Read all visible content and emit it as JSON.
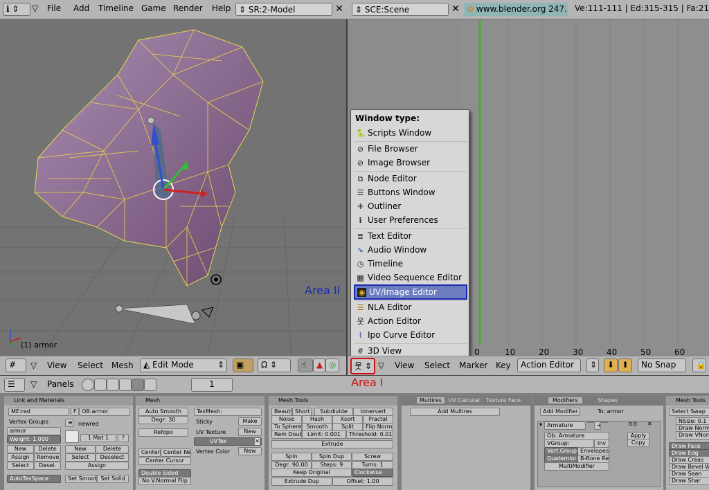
{
  "topbar": {
    "menus": [
      "File",
      "Add",
      "Timeline",
      "Game",
      "Render",
      "Help"
    ],
    "screen": "SR:2-Model",
    "scene": "SCE:Scene",
    "url": "www.blender.org 247.1",
    "stats": "Ve:111-111 | Ed:315-315 | Fa:21"
  },
  "viewport": {
    "object_label": "(1) armor",
    "area_ii_label": "Area II",
    "area_i_label": "Area I"
  },
  "left_header": {
    "view": "View",
    "select": "Select",
    "mesh": "Mesh",
    "mode": "Edit Mode"
  },
  "right_header": {
    "view": "View",
    "select": "Select",
    "marker": "Marker",
    "key": "Key",
    "editor": "Action Editor",
    "snap": "No Snap"
  },
  "ruler": [
    "0",
    "10",
    "20",
    "30",
    "40",
    "50",
    "60"
  ],
  "menu": {
    "title": "Window type:",
    "items": [
      {
        "label": "Scripts Window",
        "icon": "scripts-icon"
      },
      {
        "label": "File Browser",
        "icon": "file-browser-icon"
      },
      {
        "label": "Image Browser",
        "icon": "image-browser-icon"
      },
      {
        "label": "Node Editor",
        "icon": "node-editor-icon"
      },
      {
        "label": "Buttons Window",
        "icon": "buttons-window-icon"
      },
      {
        "label": "Outliner",
        "icon": "outliner-icon"
      },
      {
        "label": "User Preferences",
        "icon": "info-icon"
      },
      {
        "label": "Text Editor",
        "icon": "text-editor-icon"
      },
      {
        "label": "Audio Window",
        "icon": "audio-icon"
      },
      {
        "label": "Timeline",
        "icon": "timeline-icon"
      },
      {
        "label": "Video Sequence Editor",
        "icon": "sequence-icon"
      },
      {
        "label": "UV/Image Editor",
        "icon": "uv-image-icon"
      },
      {
        "label": "NLA Editor",
        "icon": "nla-icon"
      },
      {
        "label": "Action Editor",
        "icon": "action-icon"
      },
      {
        "label": "Ipo Curve Editor",
        "icon": "ipo-icon"
      },
      {
        "label": "3D View",
        "icon": "3d-view-icon"
      }
    ],
    "highlighted": "UV/Image Editor"
  },
  "panels_bar": {
    "label": "Panels",
    "frame": "1"
  },
  "link_materials": {
    "title": "Link and Materials",
    "me": "ME:red",
    "f": "F",
    "ob": "OB:armor",
    "vertex_groups": "Vertex Groups",
    "newred": "newred",
    "group": "armor",
    "weight": "Weight: 1.000",
    "mat": "1 Mat 1",
    "q": "?",
    "new": "New",
    "delete": "Delete",
    "assign": "Assign",
    "remove": "Remove",
    "select": "Select",
    "desel": "Desel.",
    "deselect": "Deselect",
    "autotex": "AutoTexSpace",
    "set_smooth": "Set Smoot",
    "set_solid": "Set Solid"
  },
  "mesh_panel": {
    "title": "Mesh",
    "auto_smooth": "Auto Smooth",
    "degr": "Degr: 30",
    "refopo": "Refopo",
    "center": "Center",
    "center_new": "Center New",
    "center_cursor": "Center Cursor",
    "double_sided": "Double Sided",
    "no_vnormal": "No V.Normal Flip",
    "texmesh": "TexMesh:",
    "sticky": "Sticky",
    "make": "Make",
    "uv_texture": "UV Texture",
    "new": "New",
    "uvtex": "UVTex",
    "vertex_color": "Vertex Color",
    "new2": "New"
  },
  "mesh_tools": {
    "title": "Mesh Tools",
    "beauty": "Beauty",
    "short": "Short",
    "subdivide": "Subdivide",
    "innervert": "Innervert",
    "noise": "Noise",
    "hash": "Hash",
    "xsort": "Xsort",
    "fractal": "Fractal",
    "to_sphere": "To Sphere",
    "smooth": "Smooth",
    "split": "Split",
    "flip_normal": "Flip Normal",
    "rem_doubl": "Rem Doubl",
    "limit": "Limit: 0.001",
    "threshold": "Threshold: 0.010",
    "extrude": "Extrude",
    "spin": "Spin",
    "spin_dup": "Spin Dup",
    "screw": "Screw",
    "degr": "Degr: 90.00",
    "steps": "Steps: 9",
    "turns": "Turns: 1",
    "keep_original": "Keep Original",
    "clockwise": "Clockwise",
    "extrude_dup": "Extrude Dup",
    "offset": "Offset: 1.00"
  },
  "multires": {
    "tabs": [
      "Multires",
      "UV Calculat",
      "Texture Face"
    ],
    "add": "Add Multires"
  },
  "modifiers": {
    "tabs": [
      "Modifiers",
      "Shapes"
    ],
    "add": "Add Modifier",
    "to": "To: armor",
    "armature": "Armature",
    "ob": "Ob: Armature",
    "apply": "Apply",
    "copy": "Copy",
    "vgroup": "VGroup:",
    "inv": "Inv",
    "vert_group": "Vert.Group",
    "envelopes": "Envelopes",
    "quaternion": "Quaternion",
    "bbone": "B-Bone Re",
    "multimodifier": "MultiModifier"
  },
  "mesh_tools_more": {
    "title": "Mesh Tools",
    "items": [
      "Select Swap",
      "NSize: 0.1",
      "Draw Norm",
      "Draw VNorm",
      "Draw Face",
      "Draw Edg",
      "Draw Creas",
      "Draw Bevel W",
      "Draw Sean",
      "Draw Shar"
    ]
  }
}
